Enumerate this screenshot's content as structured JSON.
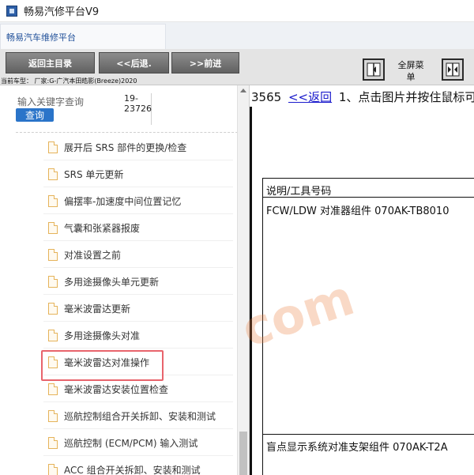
{
  "window": {
    "title": "畅易汽修平台V9"
  },
  "tabs": [
    {
      "label": "畅易汽车维修平台"
    }
  ],
  "toolbar": {
    "back_main_label": "返回主目录",
    "back_label": "<<后退.",
    "forward_label": ">>前进",
    "vehicle_info": "当前车型：  厂家:G-广汽本田皓影(Breeze)2020",
    "fullscreen_label": "全屏菜单"
  },
  "sidebar": {
    "search_placeholder": "输入关键字查询",
    "search_button": "查询",
    "code_line1": "19-",
    "code_line2": "23726",
    "items": [
      {
        "label": "展开后 SRS 部件的更换/检查"
      },
      {
        "label": "SRS 单元更新"
      },
      {
        "label": "偏摆率-加速度中间位置记忆"
      },
      {
        "label": "气囊和张紧器报废"
      },
      {
        "label": "对准设置之前"
      },
      {
        "label": "多用途摄像头单元更新"
      },
      {
        "label": "毫米波雷达更新"
      },
      {
        "label": "多用途摄像头对准"
      },
      {
        "label": "毫米波雷达对准操作"
      },
      {
        "label": "毫米波雷达安装位置检查"
      },
      {
        "label": "巡航控制组合开关拆卸、安装和测试"
      },
      {
        "label": "巡航控制 (ECM/PCM) 输入测试"
      },
      {
        "label": "ACC 组合开关拆卸、安装和测试"
      }
    ]
  },
  "main": {
    "page_number": "3565",
    "back_link": "<<返回",
    "instruction": "1、点击图片并按住鼠标可",
    "table": {
      "header": "说明/工具号码",
      "row1": "FCW/LDW 对准器组件 070AK-TB8010",
      "row2": "盲点显示系统对准支架组件 070AK-T2A"
    },
    "watermark": "com"
  },
  "colors": {
    "accent": "#2a74c9",
    "highlight": "#e8646c"
  }
}
